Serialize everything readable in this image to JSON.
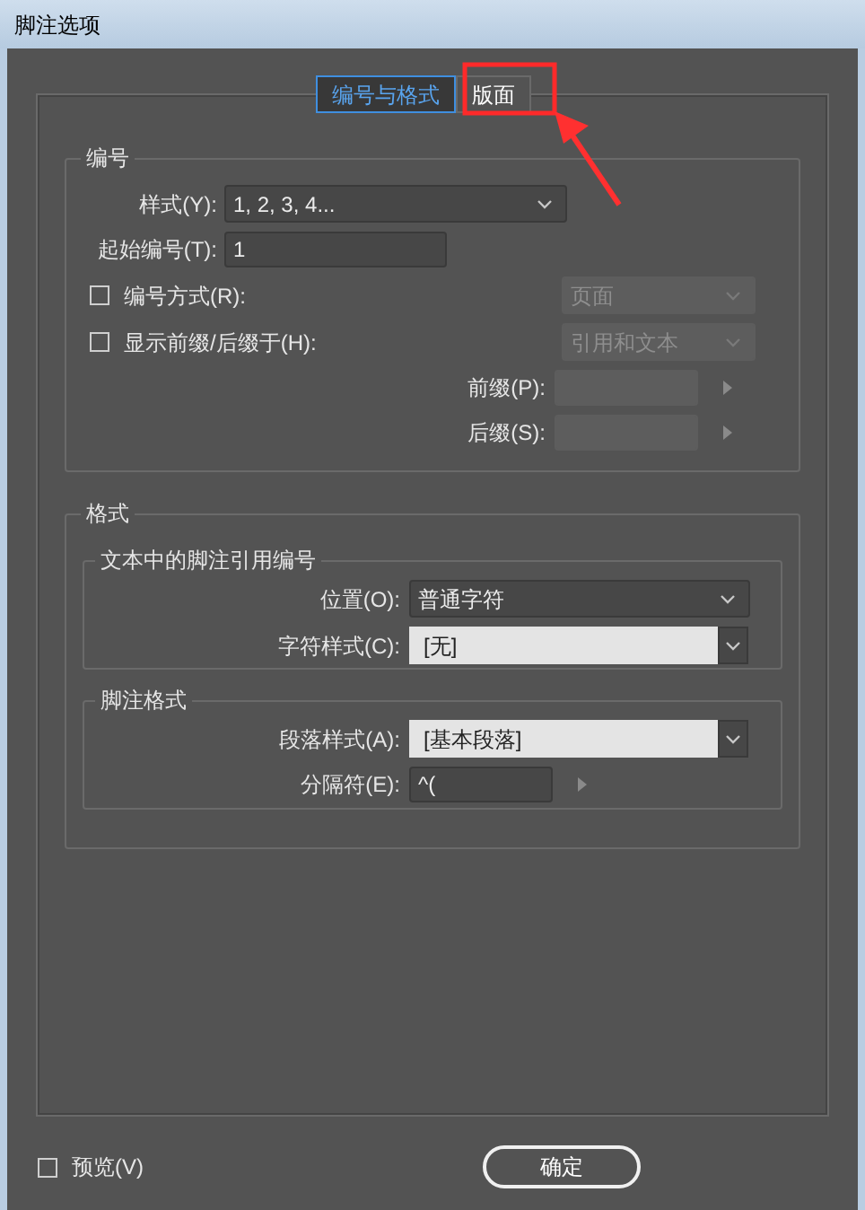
{
  "window": {
    "title": "脚注选项"
  },
  "tabs": [
    {
      "label": "编号与格式",
      "selected": true
    },
    {
      "label": "版面",
      "selected": false
    }
  ],
  "numbering": {
    "title": "编号",
    "style": {
      "label": "样式(Y):",
      "value": "1, 2, 3, 4..."
    },
    "start": {
      "label": "起始编号(T):",
      "value": "1"
    },
    "restart": {
      "label": "编号方式(R):",
      "checked": false,
      "value": "页面",
      "disabled": true
    },
    "show_prefix": {
      "label": "显示前缀/后缀于(H):",
      "checked": false,
      "value": "引用和文本",
      "disabled": true
    },
    "prefix": {
      "label": "前缀(P):",
      "disabled": true
    },
    "suffix": {
      "label": "后缀(S):",
      "disabled": true
    }
  },
  "format": {
    "title": "格式",
    "reference": {
      "title": "文本中的脚注引用编号",
      "rows": [
        {
          "kind": "select",
          "label": "位置(O):",
          "value": "普通字符"
        },
        {
          "kind": "combo",
          "label": "字符样式(C):",
          "value": "[无]"
        }
      ]
    },
    "footnote": {
      "title": "脚注格式",
      "rows": [
        {
          "kind": "combo",
          "label": "段落样式(A):",
          "value": "[基本段落]"
        },
        {
          "kind": "text",
          "label": "分隔符(E):",
          "value": "^("
        }
      ]
    }
  },
  "preview": {
    "label": "预览(V)",
    "checked": false
  },
  "buttons": [
    {
      "label": "确定"
    }
  ]
}
